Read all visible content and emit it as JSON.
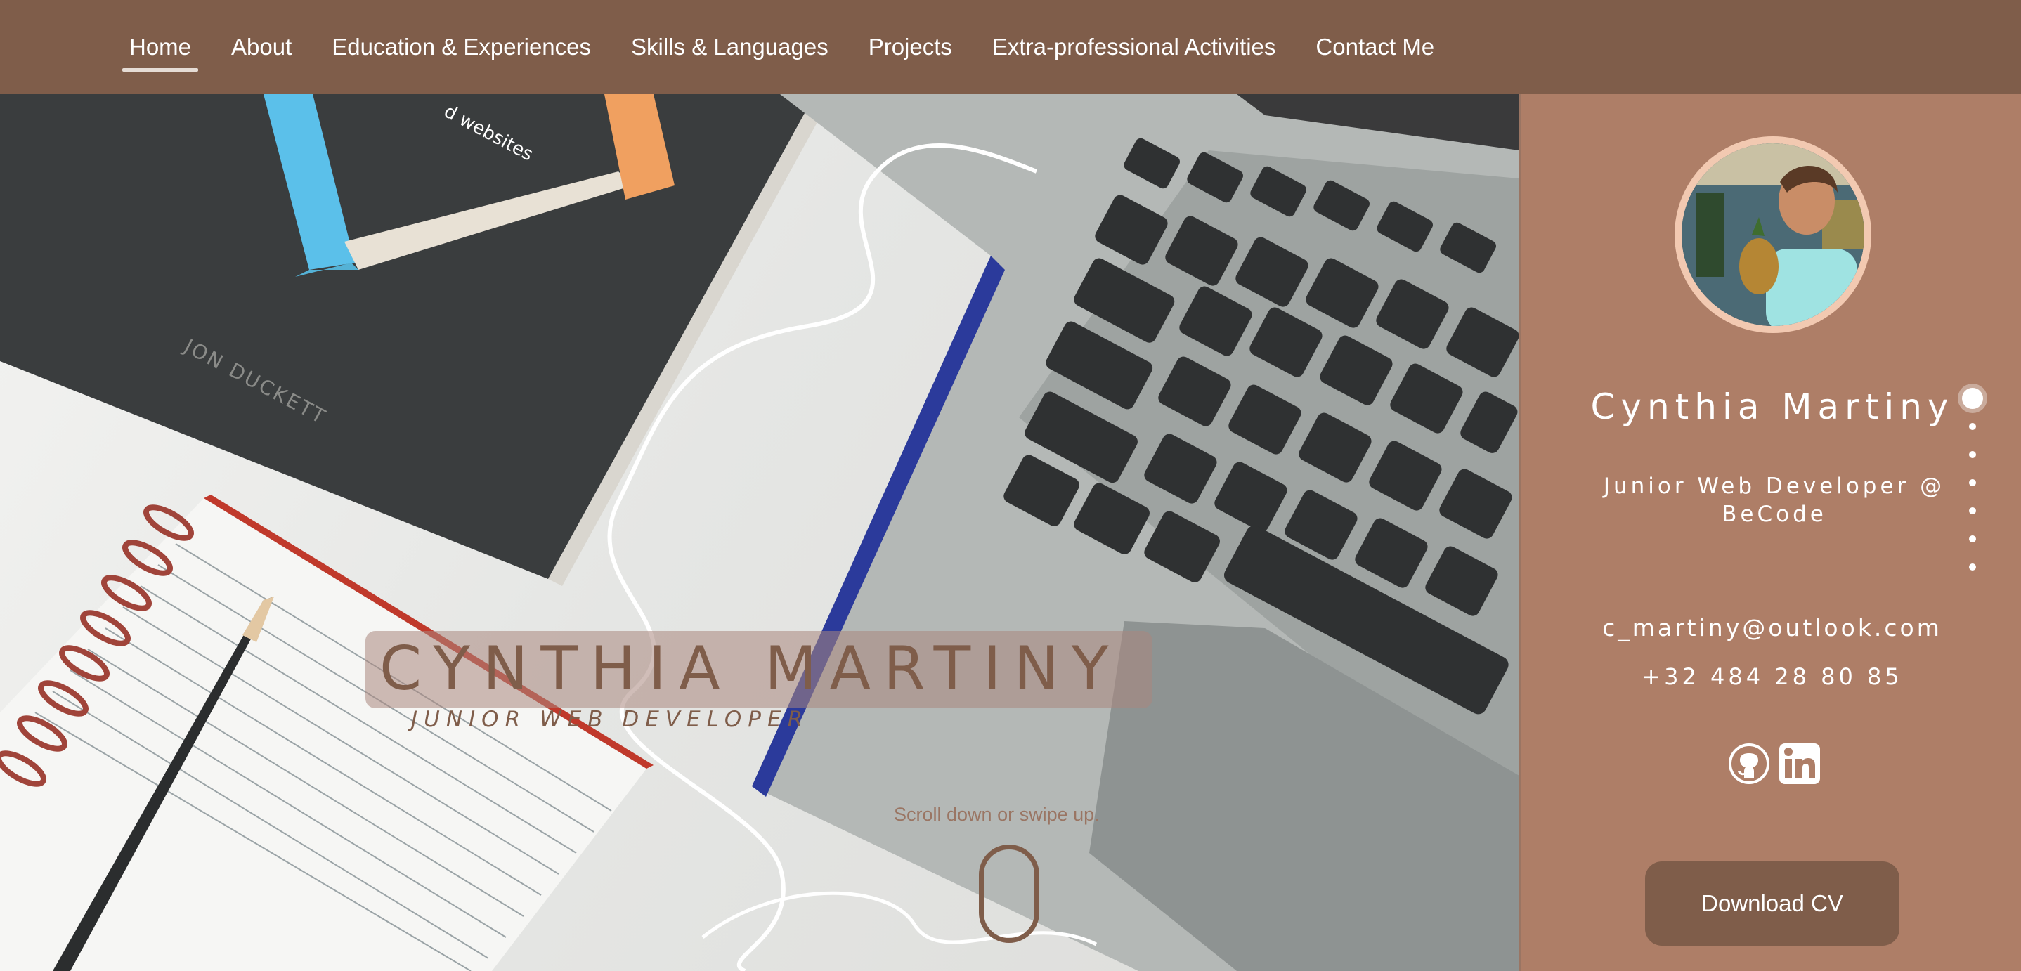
{
  "nav": {
    "items": [
      {
        "label": "Home",
        "active": true
      },
      {
        "label": "About",
        "active": false
      },
      {
        "label": "Education & Experiences",
        "active": false
      },
      {
        "label": "Skills & Languages",
        "active": false
      },
      {
        "label": "Projects",
        "active": false
      },
      {
        "label": "Extra-professional Activities",
        "active": false
      },
      {
        "label": "Contact Me",
        "active": false
      }
    ]
  },
  "hero": {
    "title": "CYNTHIA MARTINY",
    "subtitle": "JUNIOR WEB DEVELOPER",
    "scroll_hint": "Scroll down or swipe up.",
    "book_author": "JON DUCKETT",
    "book_fragment": "d websites"
  },
  "sidebar": {
    "name": "Cynthia Martiny",
    "role": "Junior Web Developer @ BeCode",
    "email": "c_martiny@outlook.com",
    "phone": "+32 484 28 80 85",
    "social": [
      {
        "icon": "github-icon"
      },
      {
        "icon": "linkedin-icon"
      }
    ],
    "cv_button": "Download CV"
  },
  "section_dots": {
    "count": 7,
    "active_index": 0
  },
  "colors": {
    "brand_brown": "#7f5d4a",
    "sidebar_bg": "#ae7e67",
    "avatar_ring": "#f2c9b1"
  }
}
